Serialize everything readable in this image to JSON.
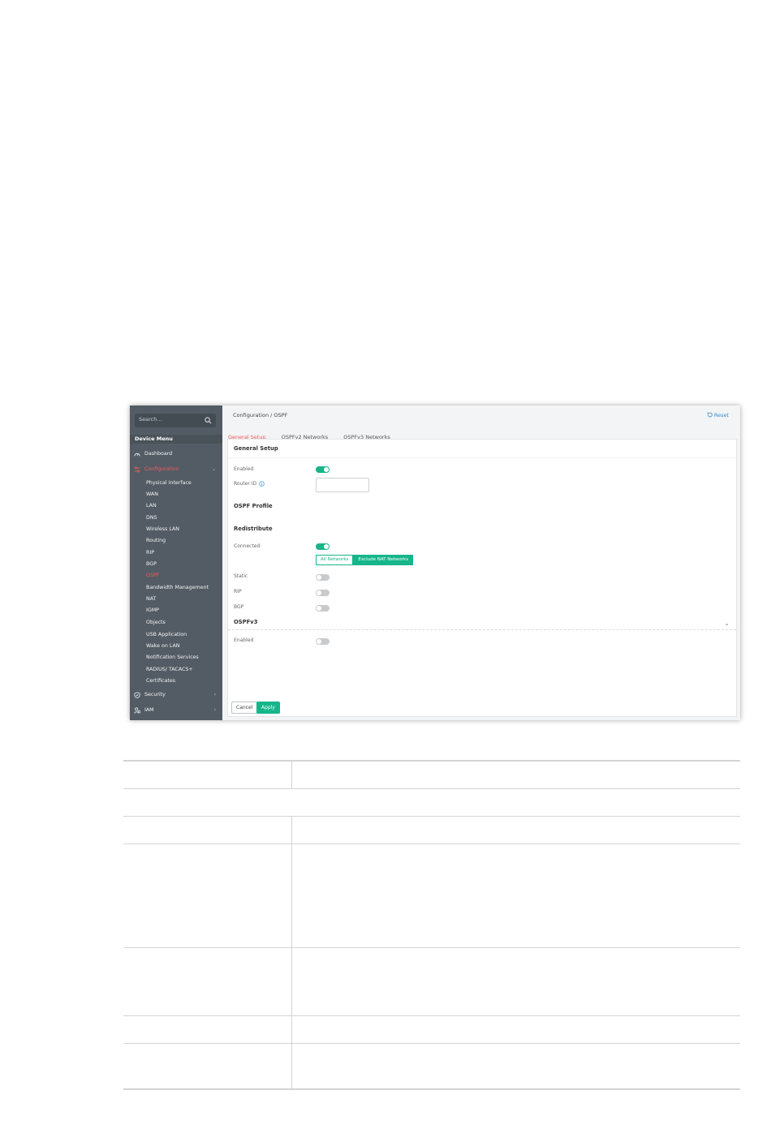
{
  "sidebar": {
    "search_placeholder": "Search...",
    "menu_title": "Device Menu",
    "items": [
      {
        "label": "Dashboard",
        "icon": "dashboard-icon"
      },
      {
        "label": "Configuration",
        "icon": "configuration-icon"
      },
      {
        "label": "Physical Interface"
      },
      {
        "label": "WAN"
      },
      {
        "label": "LAN"
      },
      {
        "label": "DNS"
      },
      {
        "label": "Wireless LAN"
      },
      {
        "label": "Routing"
      },
      {
        "label": "RIP"
      },
      {
        "label": "BGP"
      },
      {
        "label": "OSPF"
      },
      {
        "label": "Bandwidth Management"
      },
      {
        "label": "NAT"
      },
      {
        "label": "IGMP"
      },
      {
        "label": "Objects"
      },
      {
        "label": "USB Application"
      },
      {
        "label": "Wake on LAN"
      },
      {
        "label": "Notification Services"
      },
      {
        "label": "RADIUS/ TACACS+"
      },
      {
        "label": "Certificates"
      },
      {
        "label": "Security",
        "icon": "shield-icon"
      },
      {
        "label": "IAM",
        "icon": "iam-icon"
      }
    ]
  },
  "header": {
    "breadcrumb": "Configuration / OSPF",
    "reset_label": "Reset"
  },
  "tabs": [
    {
      "label": "General Setup"
    },
    {
      "label": "OSPFv2 Networks"
    },
    {
      "label": "OSPFv3 Networks"
    }
  ],
  "form": {
    "general_title": "General Setup",
    "enabled_label": "Enabled",
    "router_id_label": "Router ID",
    "router_id_value": "",
    "ospf_profile_title": "OSPF Profile",
    "redistribute_title": "Redistribute",
    "connected_label": "Connected",
    "all_networks_label": "All Networks",
    "exclude_nat_label": "Exclude NAT Networks",
    "static_label": "Static",
    "rip_label": "RIP",
    "bgp_label": "BGP",
    "ospfv3_title": "OSPFv3",
    "ospfv3_enabled_label": "Enabled",
    "toggles": {
      "enabled": true,
      "connected": true,
      "static": false,
      "rip": false,
      "bgp": false,
      "ospfv3_enabled": false
    }
  },
  "buttons": {
    "cancel": "Cancel",
    "apply": "Apply"
  },
  "colors": {
    "accent_green": "#16b58a",
    "active_red": "#f05a5a",
    "sidebar_bg": "#535c64",
    "link_blue": "#2f8fd8"
  }
}
